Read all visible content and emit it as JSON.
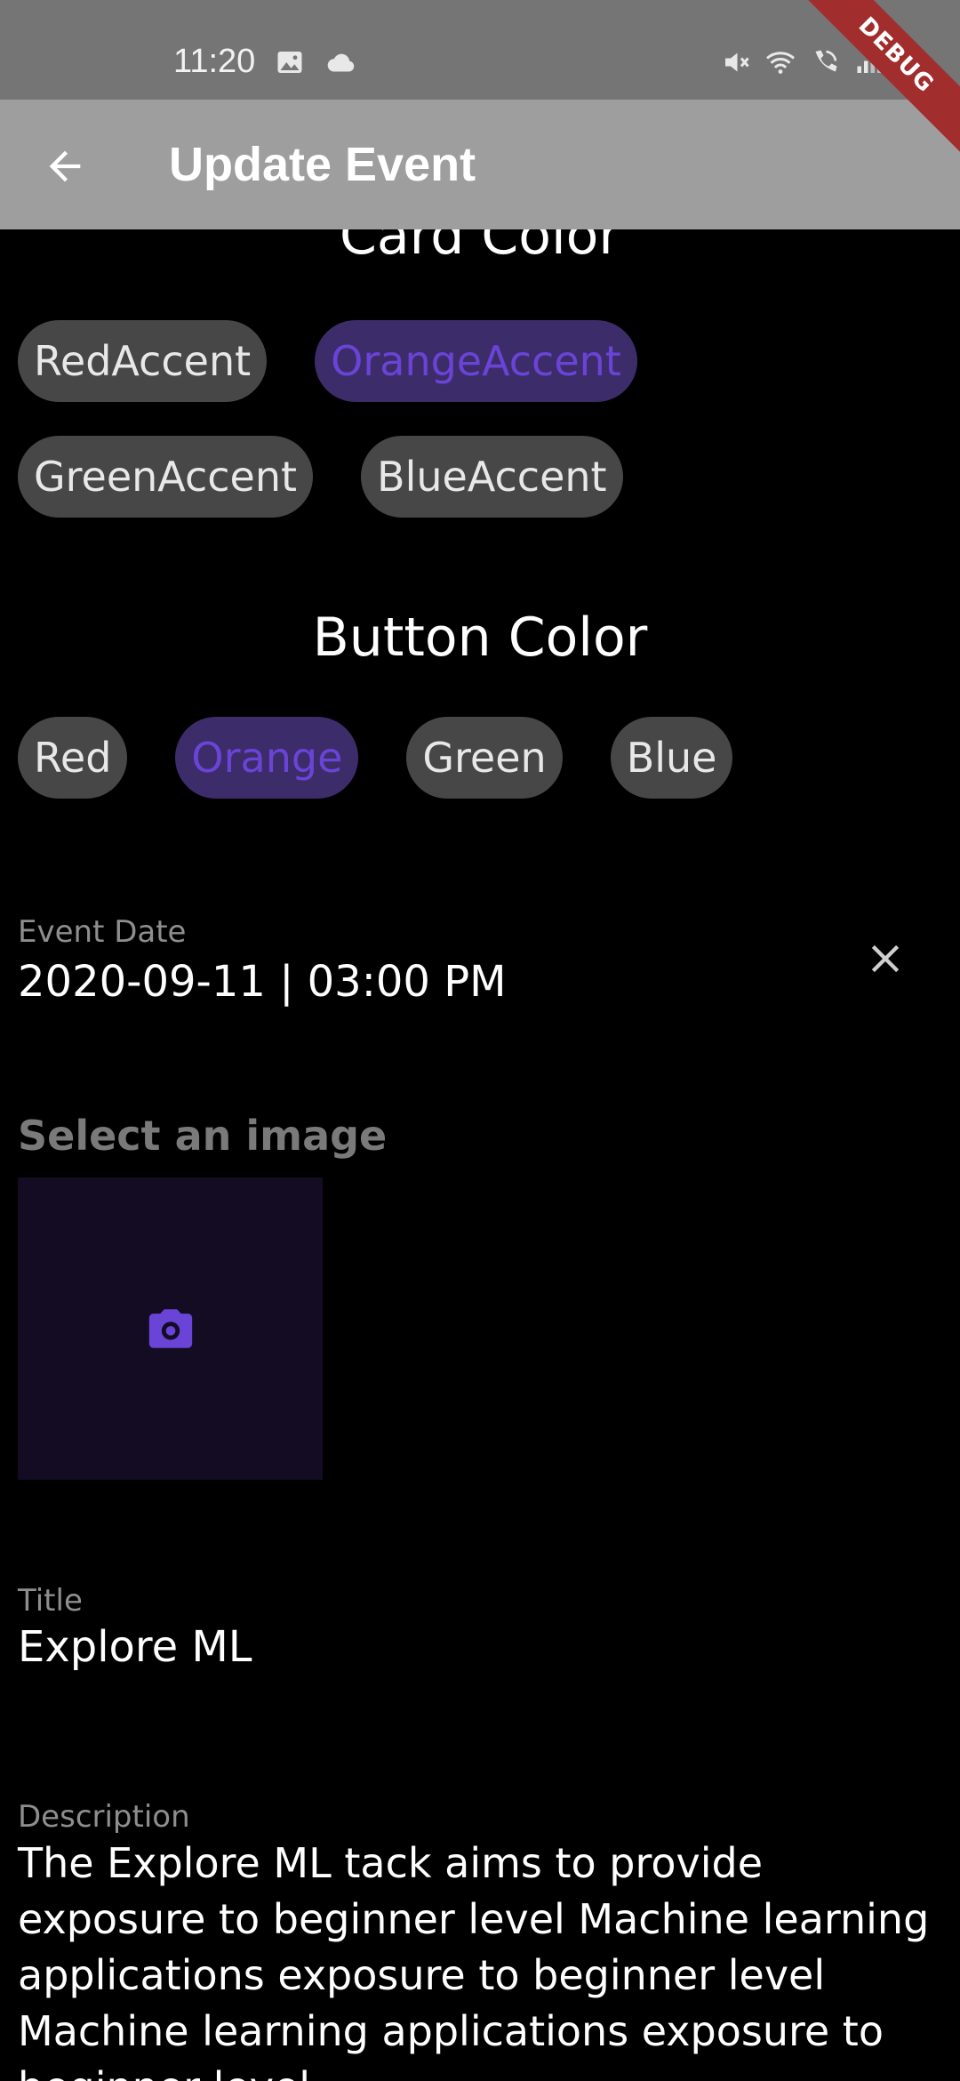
{
  "status_bar": {
    "time": "11:20",
    "left_icons": [
      "image-icon",
      "cloud-icon"
    ],
    "right_icons": [
      "mute-icon",
      "wifi-icon",
      "wifi-calling-icon",
      "signal-icon",
      "battery-icon"
    ]
  },
  "debug_banner": "DEBUG",
  "app_bar": {
    "title": "Update Event",
    "back_icon": "arrow-back-icon"
  },
  "card_color": {
    "title": "Card Color",
    "options": [
      {
        "label": "RedAccent",
        "selected": false
      },
      {
        "label": "OrangeAccent",
        "selected": true
      },
      {
        "label": "GreenAccent",
        "selected": false
      },
      {
        "label": "BlueAccent",
        "selected": false
      }
    ]
  },
  "button_color": {
    "title": "Button Color",
    "options": [
      {
        "label": "Red",
        "selected": false
      },
      {
        "label": "Orange",
        "selected": true
      },
      {
        "label": "Green",
        "selected": false
      },
      {
        "label": "Blue",
        "selected": false
      }
    ]
  },
  "event_date": {
    "label": "Event Date",
    "value": "2020-09-11 | 03:00 PM",
    "clear_icon": "close-icon"
  },
  "image_picker": {
    "label": "Select an image",
    "icon": "camera-icon"
  },
  "title_field": {
    "label": "Title",
    "value": "Explore ML"
  },
  "description_field": {
    "label": "Description",
    "value": "The Explore ML tack aims to provide exposure to beginner level Machine learning applications exposure to beginner level Machine learning applications  exposure to beginner level"
  },
  "colors": {
    "status_bar": "#757575",
    "app_bar": "#9e9e9e",
    "background": "#000000",
    "chip": "#474747",
    "chip_selected_bg": "#3d2c6a",
    "chip_selected_text": "#6a44d6",
    "image_picker_bg": "#130c22",
    "debug_ribbon": "#a12d2d"
  }
}
